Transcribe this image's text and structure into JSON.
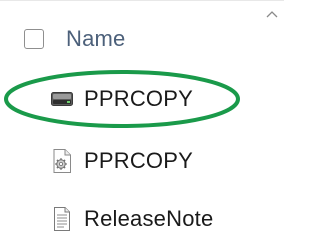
{
  "header": {
    "column_label": "Name",
    "sort_icon": "chevron-up-icon",
    "checkbox_checked": false
  },
  "files": [
    {
      "name": "PPRCOPY",
      "icon": "drive-image-icon",
      "highlighted": true
    },
    {
      "name": "PPRCOPY",
      "icon": "settings-file-icon",
      "highlighted": false
    },
    {
      "name": "ReleaseNote",
      "icon": "text-document-icon",
      "highlighted": false
    }
  ],
  "annotation": {
    "shape": "ellipse",
    "color": "#1a9a4a"
  }
}
